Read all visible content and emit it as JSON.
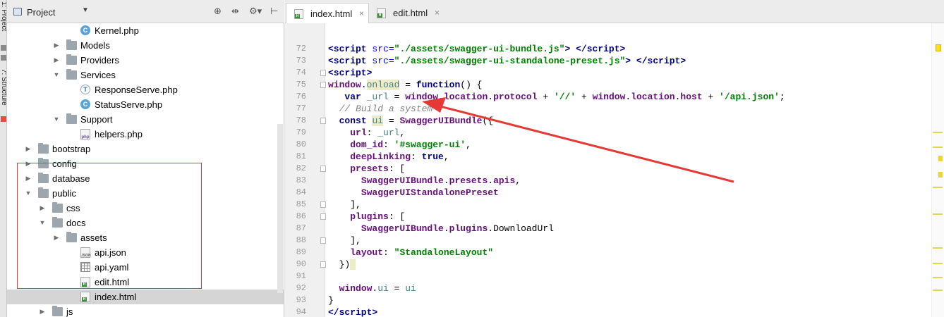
{
  "tool_strip": {
    "labels": [
      "1: Project",
      "7: Structure"
    ]
  },
  "project_panel": {
    "title": "Project",
    "dropdown_icon": "chevron-down-icon",
    "header_icons": [
      "target-icon",
      "collapse-icon",
      "gear-icon",
      "hide-icon"
    ]
  },
  "tree": [
    {
      "label": "Kernel.php",
      "icon": "class-icon",
      "expanded": null
    },
    {
      "label": "Models",
      "icon": "folder-icon",
      "expanded": false
    },
    {
      "label": "Providers",
      "icon": "folder-icon",
      "expanded": false
    },
    {
      "label": "Services",
      "icon": "folder-icon",
      "expanded": true
    },
    {
      "label": "ResponseServe.php",
      "icon": "trait-icon",
      "expanded": null
    },
    {
      "label": "StatusServe.php",
      "icon": "class-icon",
      "expanded": null
    },
    {
      "label": "Support",
      "icon": "folder-icon",
      "expanded": true
    },
    {
      "label": "helpers.php",
      "icon": "php-file-icon",
      "expanded": null
    },
    {
      "label": "bootstrap",
      "icon": "folder-icon",
      "expanded": false
    },
    {
      "label": "config",
      "icon": "folder-icon",
      "expanded": false
    },
    {
      "label": "database",
      "icon": "folder-icon",
      "expanded": false
    },
    {
      "label": "public",
      "icon": "folder-icon",
      "expanded": true
    },
    {
      "label": "css",
      "icon": "folder-icon",
      "expanded": false
    },
    {
      "label": "docs",
      "icon": "folder-icon",
      "expanded": true
    },
    {
      "label": "assets",
      "icon": "folder-icon",
      "expanded": false
    },
    {
      "label": "api.json",
      "icon": "json-file-icon",
      "expanded": null
    },
    {
      "label": "api.yaml",
      "icon": "yaml-file-icon",
      "expanded": null
    },
    {
      "label": "edit.html",
      "icon": "html-file-icon",
      "expanded": null
    },
    {
      "label": "index.html",
      "icon": "html-file-icon",
      "expanded": null,
      "selected": true
    },
    {
      "label": "js",
      "icon": "folder-icon",
      "expanded": false
    }
  ],
  "tabs": [
    {
      "label": "index.html",
      "active": true,
      "close": "×"
    },
    {
      "label": "edit.html",
      "active": false,
      "close": "×"
    }
  ],
  "editor": {
    "lines": [
      {
        "n": "72",
        "html": "<span class=\"tagname\">&lt;script</span> <span class=\"attr\">src=</span><span class=\"str\">\"./assets/swagger-ui-bundle.js\"</span><span class=\"tagname\">&gt;</span> <span class=\"tagname\">&lt;/script&gt;</span>",
        "indent": 0
      },
      {
        "n": "73",
        "html": "<span class=\"tagname\">&lt;script</span> <span class=\"attr\">src=</span><span class=\"str\">\"./assets/swagger-ui-standalone-preset.js\"</span><span class=\"tagname\">&gt;</span> <span class=\"tagname\">&lt;/script&gt;</span>",
        "indent": 0
      },
      {
        "n": "74",
        "html": "<span class=\"tagname\">&lt;script&gt;</span>",
        "indent": 0
      },
      {
        "n": "75",
        "html": "<span class=\"prop\">window</span>.<span class=\"var-hl\">onload</span> = <span class=\"kw\">function</span>() {",
        "indent": 0
      },
      {
        "n": "76",
        "html": "   <span class=\"kw\">var</span> <span class=\"var\">_url</span> = <span class=\"prop\">window</span>.<span class=\"prop\">location</span>.<span class=\"prop\">protocol</span> + <span class=\"str\">'//'</span> + <span class=\"prop\">window</span>.<span class=\"prop\">location</span>.<span class=\"prop\">host</span> + <span class=\"str\">'/api.json'</span>;",
        "indent": 0
      },
      {
        "n": "77",
        "html": "  <span class=\"cmt\">// Build a system</span>",
        "indent": 0
      },
      {
        "n": "78",
        "html": "  <span class=\"kw\">const</span> <span class=\"var-hl\">ui</span> = <span class=\"prop\">SwaggerUIBundle</span>({",
        "indent": 0
      },
      {
        "n": "79",
        "html": "    <span class=\"prop\">url</span>: <span class=\"var\">_url</span>,",
        "indent": 0
      },
      {
        "n": "80",
        "html": "    <span class=\"prop\">dom_id</span>: <span class=\"str\">'#swagger-ui'</span>,",
        "indent": 0
      },
      {
        "n": "81",
        "html": "    <span class=\"prop\">deepLinking</span>: <span class=\"kw\">true</span>,",
        "indent": 0
      },
      {
        "n": "82",
        "html": "    <span class=\"prop\">presets</span>: [",
        "indent": 0
      },
      {
        "n": "83",
        "html": "      <span class=\"prop\">SwaggerUIBundle</span>.<span class=\"prop\">presets</span>.<span class=\"prop\">apis</span>,",
        "indent": 0
      },
      {
        "n": "84",
        "html": "      <span class=\"prop\">SwaggerUIStandalonePreset</span>",
        "indent": 0
      },
      {
        "n": "85",
        "html": "    ],",
        "indent": 0
      },
      {
        "n": "86",
        "html": "    <span class=\"prop\">plugins</span>: [",
        "indent": 0
      },
      {
        "n": "87",
        "html": "      <span class=\"prop\">SwaggerUIBundle</span>.<span class=\"prop\">plugins</span>.DownloadUrl",
        "indent": 0
      },
      {
        "n": "88",
        "html": "    ],",
        "indent": 0
      },
      {
        "n": "89",
        "html": "    <span class=\"prop\">layout</span>: <span class=\"str\">\"StandaloneLayout\"</span>",
        "indent": 0
      },
      {
        "n": "90",
        "html": "  })<span class=\"hl\"> </span>",
        "indent": 0
      },
      {
        "n": "91",
        "html": "",
        "indent": 0
      },
      {
        "n": "92",
        "html": "  <span class=\"prop\">window</span>.<span class=\"var\">ui</span> = <span class=\"var\">ui</span>",
        "indent": 0
      },
      {
        "n": "93",
        "html": "}",
        "indent": 0
      },
      {
        "n": "94",
        "html": "<span class=\"tagname\">&lt;/script&gt;</span>",
        "indent": 0
      }
    ]
  },
  "colors": {
    "annotation": "#e53935",
    "selection_bg": "#d5d5d5",
    "editor_bg": "#ffffff",
    "gutter_bg": "#f0f0f0"
  }
}
